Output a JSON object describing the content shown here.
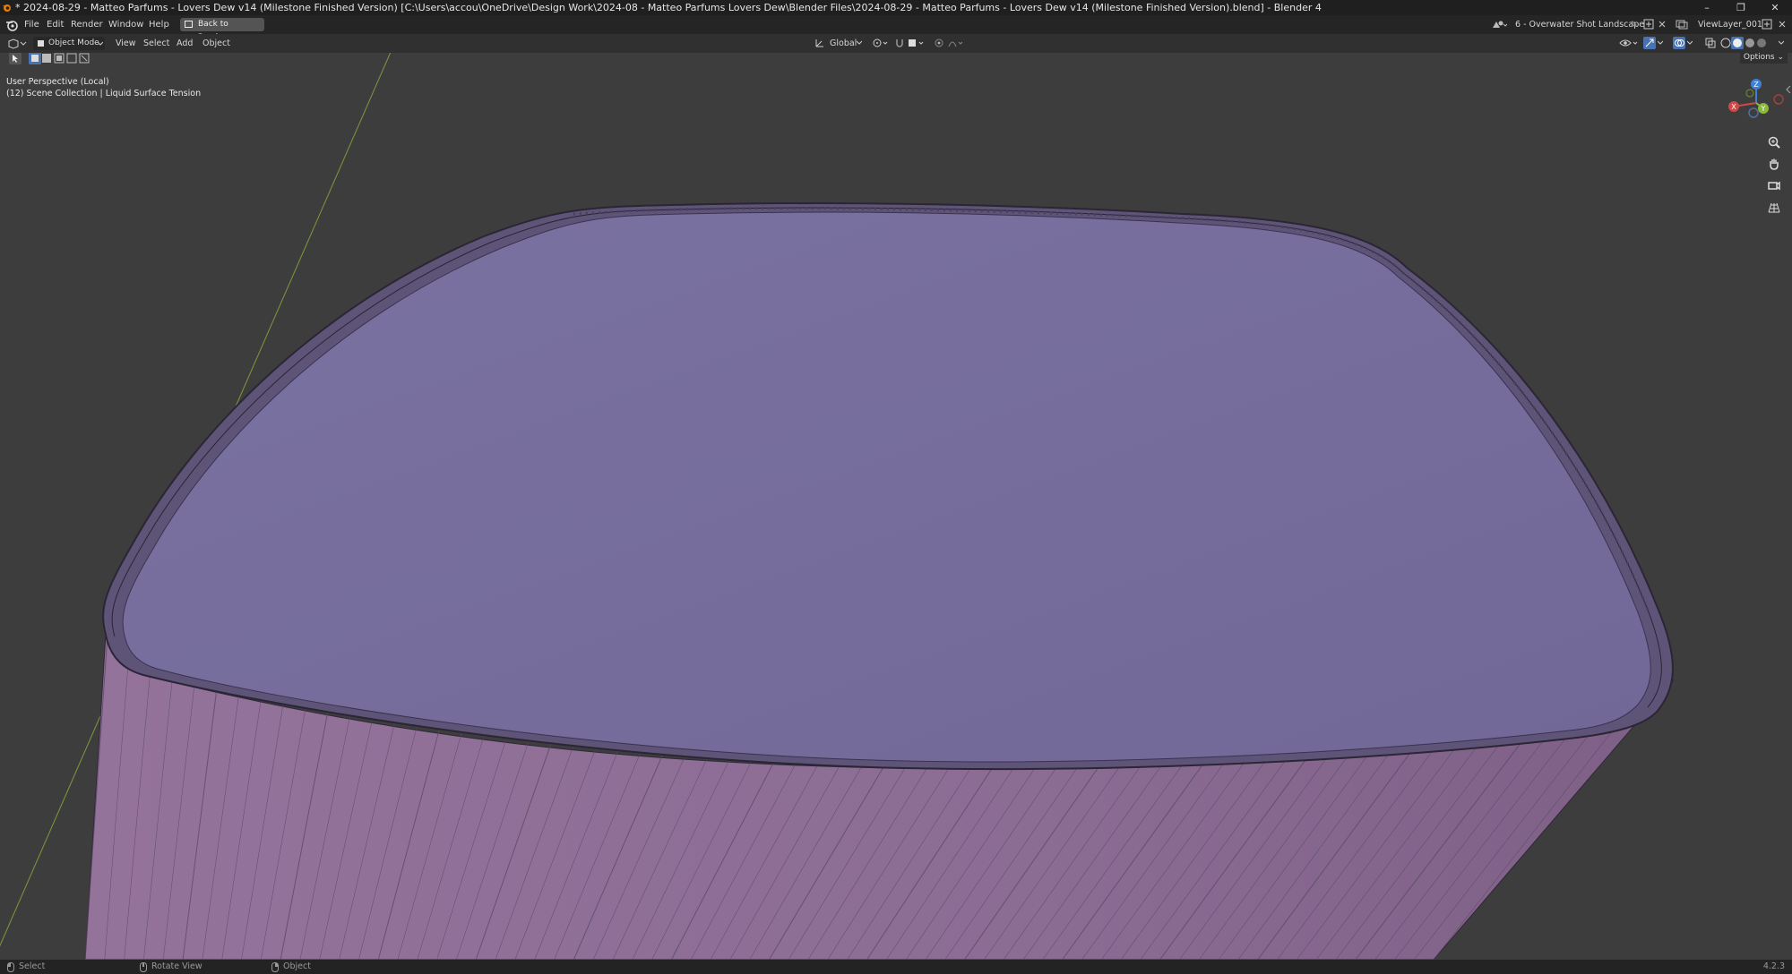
{
  "window": {
    "title": "* 2024-08-29 - Matteo Parfums - Lovers Dew v14 (Milestone Finished Version) [C:\\Users\\accou\\OneDrive\\Design Work\\2024-08 - Matteo Parfums Lovers Dew\\Blender Files\\2024-08-29 - Matteo Parfums - Lovers Dew v14 (Milestone Finished Version).blend] - Blender 4",
    "controls": [
      "–",
      "❐",
      "✕"
    ]
  },
  "menubar": {
    "items": [
      "File",
      "Edit",
      "Render",
      "Window",
      "Help"
    ],
    "back_button": "Back to Previous",
    "scene": "6 - Overwater Shot Landscape",
    "view_layer": "ViewLayer_001"
  },
  "viewport_header": {
    "mode": "Object Mode",
    "menus": [
      "View",
      "Select",
      "Add",
      "Object"
    ],
    "transform_orientation": "Global",
    "options_label": "Options"
  },
  "viewport": {
    "view_name": "User Perspective (Local)",
    "collection_info": "(12) Scene Collection | Liquid Surface Tension",
    "gizmo_axes": [
      "Z",
      "Y",
      "X"
    ],
    "colors": {
      "background": "#3d3d3d",
      "object_top": "#756c96",
      "object_side": "#8b6b91",
      "wire": "#2e2838",
      "y_axis_line": "#7d9a3c"
    }
  },
  "statusbar": {
    "items": [
      "Select",
      "Rotate View",
      "Object"
    ],
    "version": "4.2.3"
  }
}
